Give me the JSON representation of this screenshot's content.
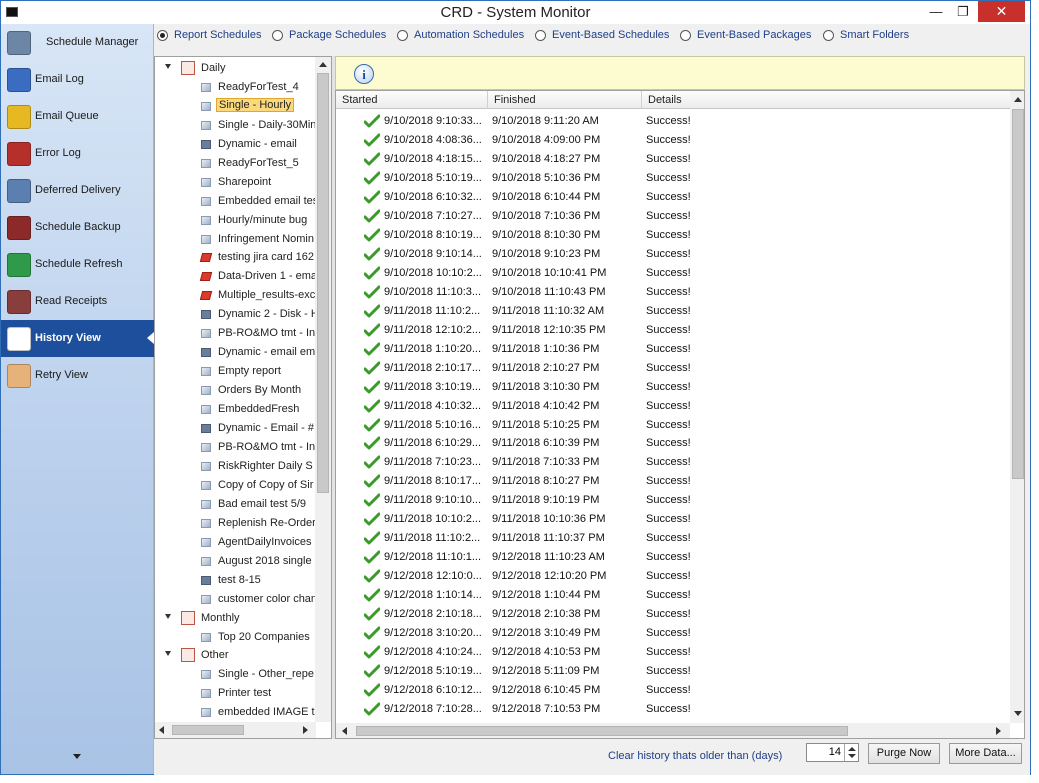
{
  "window": {
    "title": "CRD - System Monitor",
    "minimize": "—",
    "maximize": "❐",
    "close": "✕"
  },
  "sidebar": {
    "items": [
      {
        "label": "Schedule Manager",
        "icon": "schedule-manager-icon"
      },
      {
        "label": "Email Log",
        "icon": "email-log-icon"
      },
      {
        "label": "Email Queue",
        "icon": "email-queue-icon"
      },
      {
        "label": "Error Log",
        "icon": "error-log-icon"
      },
      {
        "label": "Deferred Delivery",
        "icon": "deferred-delivery-icon"
      },
      {
        "label": "Schedule Backup",
        "icon": "schedule-backup-icon"
      },
      {
        "label": "Schedule Refresh",
        "icon": "schedule-refresh-icon"
      },
      {
        "label": "Read Receipts",
        "icon": "read-receipts-icon"
      },
      {
        "label": "History View",
        "icon": "history-view-icon"
      },
      {
        "label": "Retry View",
        "icon": "retry-view-icon"
      }
    ],
    "active_index": 8
  },
  "filters": {
    "options": [
      {
        "label": "Report Schedules",
        "selected": true
      },
      {
        "label": "Package Schedules",
        "selected": false
      },
      {
        "label": "Automation Schedules",
        "selected": false
      },
      {
        "label": "Event-Based Schedules",
        "selected": false
      },
      {
        "label": "Event-Based Packages",
        "selected": false
      },
      {
        "label": "Smart Folders",
        "selected": false
      }
    ]
  },
  "tree": {
    "folders": [
      {
        "label": "Daily",
        "children": [
          {
            "label": "ReadyForTest_4",
            "kind": "report"
          },
          {
            "label": "Single - Hourly",
            "kind": "report",
            "selected": true
          },
          {
            "label": "Single - Daily-30Min",
            "kind": "report"
          },
          {
            "label": "Dynamic - email",
            "kind": "dynamic"
          },
          {
            "label": "ReadyForTest_5",
            "kind": "report"
          },
          {
            "label": "Sharepoint",
            "kind": "report"
          },
          {
            "label": "Embedded email tes",
            "kind": "report"
          },
          {
            "label": "Hourly/minute bug",
            "kind": "report"
          },
          {
            "label": "Infringement Nomin",
            "kind": "report"
          },
          {
            "label": "testing jira card 162",
            "kind": "data-driven"
          },
          {
            "label": "Data-Driven 1 - ema",
            "kind": "data-driven"
          },
          {
            "label": "Multiple_results-exc",
            "kind": "data-driven"
          },
          {
            "label": "Dynamic 2 - Disk - H",
            "kind": "dynamic"
          },
          {
            "label": "PB-RO&MO tmt - In",
            "kind": "report"
          },
          {
            "label": "Dynamic - email em",
            "kind": "dynamic"
          },
          {
            "label": "Empty report",
            "kind": "report"
          },
          {
            "label": "Orders By Month",
            "kind": "report"
          },
          {
            "label": "EmbeddedFresh",
            "kind": "report"
          },
          {
            "label": "Dynamic - Email - #",
            "kind": "dynamic"
          },
          {
            "label": "PB-RO&MO tmt - In",
            "kind": "report"
          },
          {
            "label": "RiskRighter Daily S",
            "kind": "report"
          },
          {
            "label": "Copy of Copy of Sir",
            "kind": "report"
          },
          {
            "label": "Bad email test 5/9",
            "kind": "report"
          },
          {
            "label": "Replenish Re-Order",
            "kind": "report"
          },
          {
            "label": "AgentDailyInvoices",
            "kind": "report"
          },
          {
            "label": "August 2018 single",
            "kind": "report"
          },
          {
            "label": "test 8-15",
            "kind": "dynamic"
          },
          {
            "label": "customer color chan",
            "kind": "report"
          }
        ]
      },
      {
        "label": "Monthly",
        "children": [
          {
            "label": "Top 20 Companies",
            "kind": "report"
          }
        ]
      },
      {
        "label": "Other",
        "children": [
          {
            "label": "Single - Other_repe",
            "kind": "report"
          },
          {
            "label": "Printer test",
            "kind": "report"
          },
          {
            "label": "embedded IMAGE te",
            "kind": "report"
          }
        ]
      }
    ]
  },
  "info": {
    "icon": "info-icon",
    "glyph": "i"
  },
  "history": {
    "columns": [
      "Started",
      "Finished",
      "Details"
    ],
    "rows": [
      {
        "started": "9/10/2018 9:10:33...",
        "finished": "9/10/2018 9:11:20 AM",
        "details": "Success!"
      },
      {
        "started": "9/10/2018 4:08:36...",
        "finished": "9/10/2018 4:09:00 PM",
        "details": "Success!"
      },
      {
        "started": "9/10/2018 4:18:15...",
        "finished": "9/10/2018 4:18:27 PM",
        "details": "Success!"
      },
      {
        "started": "9/10/2018 5:10:19...",
        "finished": "9/10/2018 5:10:36 PM",
        "details": "Success!"
      },
      {
        "started": "9/10/2018 6:10:32...",
        "finished": "9/10/2018 6:10:44 PM",
        "details": "Success!"
      },
      {
        "started": "9/10/2018 7:10:27...",
        "finished": "9/10/2018 7:10:36 PM",
        "details": "Success!"
      },
      {
        "started": "9/10/2018 8:10:19...",
        "finished": "9/10/2018 8:10:30 PM",
        "details": "Success!"
      },
      {
        "started": "9/10/2018 9:10:14...",
        "finished": "9/10/2018 9:10:23 PM",
        "details": "Success!"
      },
      {
        "started": "9/10/2018 10:10:2...",
        "finished": "9/10/2018 10:10:41 PM",
        "details": "Success!"
      },
      {
        "started": "9/10/2018 11:10:3...",
        "finished": "9/10/2018 11:10:43 PM",
        "details": "Success!"
      },
      {
        "started": "9/11/2018 11:10:2...",
        "finished": "9/11/2018 11:10:32 AM",
        "details": "Success!"
      },
      {
        "started": "9/11/2018 12:10:2...",
        "finished": "9/11/2018 12:10:35 PM",
        "details": "Success!"
      },
      {
        "started": "9/11/2018 1:10:20...",
        "finished": "9/11/2018 1:10:36 PM",
        "details": "Success!"
      },
      {
        "started": "9/11/2018 2:10:17...",
        "finished": "9/11/2018 2:10:27 PM",
        "details": "Success!"
      },
      {
        "started": "9/11/2018 3:10:19...",
        "finished": "9/11/2018 3:10:30 PM",
        "details": "Success!"
      },
      {
        "started": "9/11/2018 4:10:32...",
        "finished": "9/11/2018 4:10:42 PM",
        "details": "Success!"
      },
      {
        "started": "9/11/2018 5:10:16...",
        "finished": "9/11/2018 5:10:25 PM",
        "details": "Success!"
      },
      {
        "started": "9/11/2018 6:10:29...",
        "finished": "9/11/2018 6:10:39 PM",
        "details": "Success!"
      },
      {
        "started": "9/11/2018 7:10:23...",
        "finished": "9/11/2018 7:10:33 PM",
        "details": "Success!"
      },
      {
        "started": "9/11/2018 8:10:17...",
        "finished": "9/11/2018 8:10:27 PM",
        "details": "Success!"
      },
      {
        "started": "9/11/2018 9:10:10...",
        "finished": "9/11/2018 9:10:19 PM",
        "details": "Success!"
      },
      {
        "started": "9/11/2018 10:10:2...",
        "finished": "9/11/2018 10:10:36 PM",
        "details": "Success!"
      },
      {
        "started": "9/11/2018 11:10:2...",
        "finished": "9/11/2018 11:10:37 PM",
        "details": "Success!"
      },
      {
        "started": "9/12/2018 11:10:1...",
        "finished": "9/12/2018 11:10:23 AM",
        "details": "Success!"
      },
      {
        "started": "9/12/2018 12:10:0...",
        "finished": "9/12/2018 12:10:20 PM",
        "details": "Success!"
      },
      {
        "started": "9/12/2018 1:10:14...",
        "finished": "9/12/2018 1:10:44 PM",
        "details": "Success!"
      },
      {
        "started": "9/12/2018 2:10:18...",
        "finished": "9/12/2018 2:10:38 PM",
        "details": "Success!"
      },
      {
        "started": "9/12/2018 3:10:20...",
        "finished": "9/12/2018 3:10:49 PM",
        "details": "Success!"
      },
      {
        "started": "9/12/2018 4:10:24...",
        "finished": "9/12/2018 4:10:53 PM",
        "details": "Success!"
      },
      {
        "started": "9/12/2018 5:10:19...",
        "finished": "9/12/2018 5:11:09 PM",
        "details": "Success!"
      },
      {
        "started": "9/12/2018 6:10:12...",
        "finished": "9/12/2018 6:10:45 PM",
        "details": "Success!"
      },
      {
        "started": "9/12/2018 7:10:28...",
        "finished": "9/12/2018 7:10:53 PM",
        "details": "Success!"
      }
    ]
  },
  "footer": {
    "clear_label": "Clear history thats older than (days)",
    "days_value": "14",
    "purge_label": "Purge Now",
    "more_label": "More Data..."
  },
  "colors": {
    "sidebar_active": "#1e4f9c",
    "link_text": "#1f3f88",
    "info_bar": "#fdfbd0",
    "success_check": "#3a9a2a",
    "close_button": "#c7302b"
  }
}
